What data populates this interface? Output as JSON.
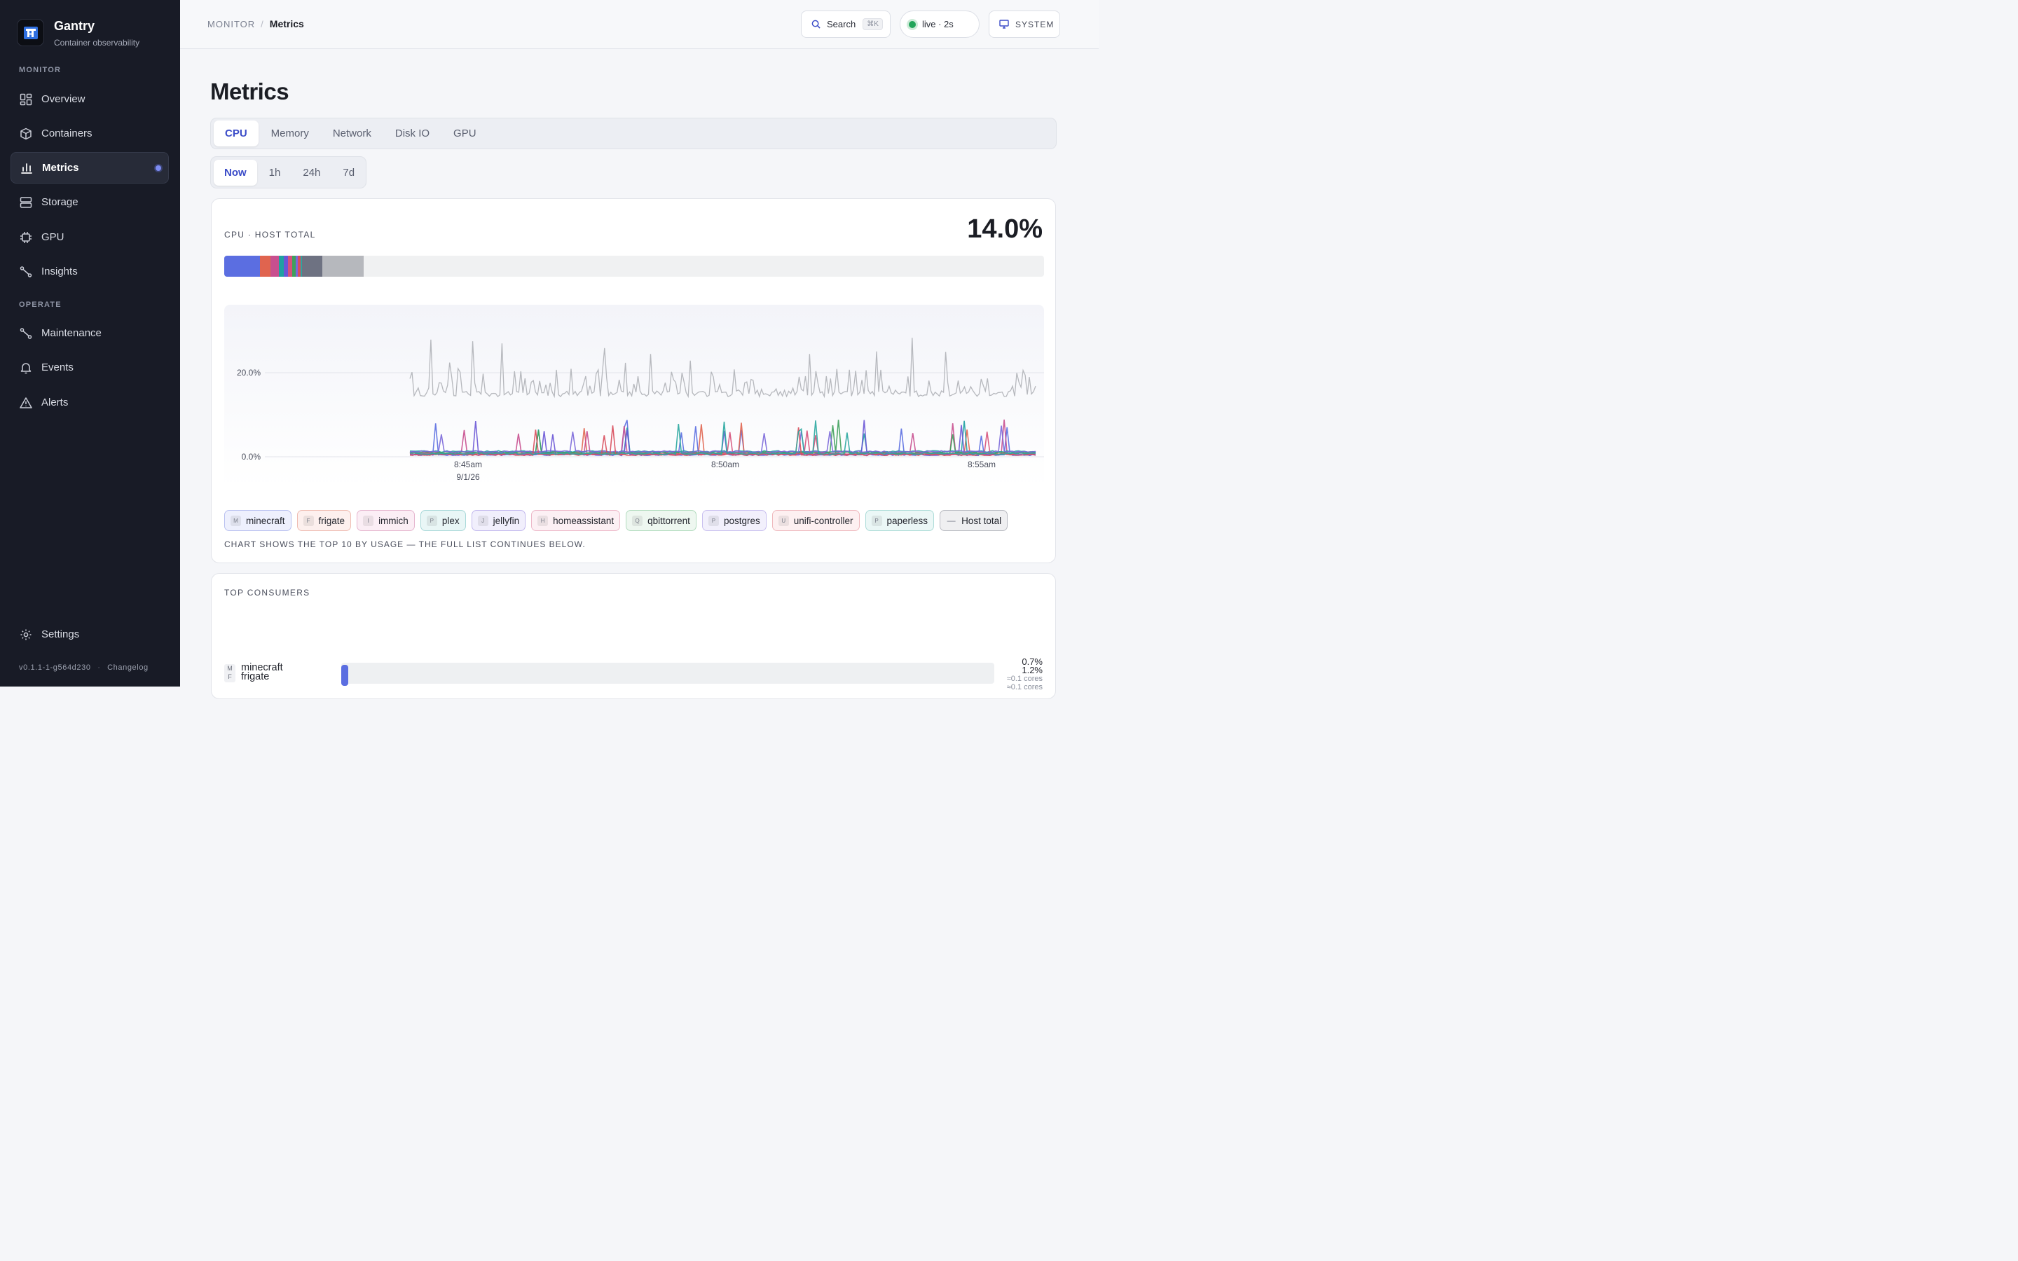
{
  "brand": {
    "name": "Gantry",
    "subtitle": "Container observability"
  },
  "sidebar": {
    "sections": [
      {
        "label": "MONITOR",
        "items": [
          {
            "label": "Overview",
            "icon": "grid-icon"
          },
          {
            "label": "Containers",
            "icon": "box-icon"
          },
          {
            "label": "Metrics",
            "icon": "bar-chart-icon",
            "active": true
          },
          {
            "label": "Storage",
            "icon": "database-icon"
          },
          {
            "label": "GPU",
            "icon": "chip-icon"
          },
          {
            "label": "Insights",
            "icon": "route-icon"
          }
        ]
      },
      {
        "label": "OPERATE",
        "items": [
          {
            "label": "Maintenance",
            "icon": "route-icon"
          },
          {
            "label": "Events",
            "icon": "bell-icon"
          },
          {
            "label": "Alerts",
            "icon": "warning-icon"
          }
        ]
      }
    ],
    "settings_label": "Settings",
    "version": "v0.1.1-1-g564d230",
    "changelog": "Changelog"
  },
  "topbar": {
    "breadcrumb_root": "MONITOR",
    "breadcrumb_current": "Metrics",
    "search_label": "Search",
    "search_shortcut": "⌘K",
    "live_label": "live · 2s",
    "theme_label": "SYSTEM"
  },
  "page": {
    "title": "Metrics",
    "tabs": [
      "CPU",
      "Memory",
      "Network",
      "Disk IO",
      "GPU"
    ],
    "active_tab": "CPU",
    "ranges": [
      "Now",
      "1h",
      "24h",
      "7d"
    ],
    "active_range": "Now"
  },
  "cpu_card": {
    "title": "CPU · HOST TOTAL",
    "value": "14.0%",
    "note": "CHART SHOWS THE TOP 10 BY USAGE — THE FULL LIST CONTINUES BELOW."
  },
  "colors": {
    "minecraft": "#5b6ee1",
    "frigate": "#e0644f",
    "immich": "#c84f8f",
    "plex": "#1fa1a1",
    "jellyfin": "#6a56d6",
    "homeassistant": "#d6517a",
    "qbittorrent": "#3fa05c",
    "postgres": "#7b68d9",
    "unifi-controller": "#d84d5b",
    "paperless": "#2aa7a0",
    "host": "#b6b8bd"
  },
  "legend": [
    {
      "badge": "M",
      "name": "minecraft",
      "bg": "#eef0fd",
      "border": "#b9c1f0"
    },
    {
      "badge": "F",
      "name": "frigate",
      "bg": "#fdf0ee",
      "border": "#efbcb2"
    },
    {
      "badge": "I",
      "name": "immich",
      "bg": "#fbeef5",
      "border": "#e6b6cf"
    },
    {
      "badge": "P",
      "name": "plex",
      "bg": "#e9f6f6",
      "border": "#a9d9d9"
    },
    {
      "badge": "J",
      "name": "jellyfin",
      "bg": "#f1effc",
      "border": "#c3b9ee"
    },
    {
      "badge": "H",
      "name": "homeassistant",
      "bg": "#fcf0f4",
      "border": "#edb8c9"
    },
    {
      "badge": "Q",
      "name": "qbittorrent",
      "bg": "#eef7f0",
      "border": "#b3dcbf"
    },
    {
      "badge": "P",
      "name": "postgres",
      "bg": "#f2f0fc",
      "border": "#c9c0ef"
    },
    {
      "badge": "U",
      "name": "unifi-controller",
      "bg": "#fdf0f1",
      "border": "#efb9be"
    },
    {
      "badge": "P",
      "name": "paperless",
      "bg": "#ebf7f6",
      "border": "#addcd8"
    },
    {
      "badge": "—",
      "name": "Host total",
      "bg": "#efeff1",
      "border": "#b9bbc2"
    }
  ],
  "chart_data": {
    "type": "line",
    "ylabel": "",
    "ylim": [
      0,
      30
    ],
    "y_ticks": [
      "0.0%",
      "20.0%"
    ],
    "x_ticks": [
      "8:45am",
      "8:50am",
      "8:55am"
    ],
    "x_date": "9/1/26",
    "host_total_range": [
      14,
      20
    ],
    "spike_times": [
      "8:44:30",
      "8:46:00",
      "8:47:00",
      "8:48:00",
      "8:49:00",
      "8:50:00",
      "8:51:00",
      "8:52:00",
      "8:53:00",
      "8:54:00",
      "8:55:30"
    ]
  },
  "stack_segments": [
    {
      "name": "minecraft",
      "pct": 4.4
    },
    {
      "name": "frigate",
      "pct": 1.2
    },
    {
      "name": "immich",
      "pct": 1.1
    },
    {
      "name": "plex",
      "pct": 0.6
    },
    {
      "name": "jellyfin",
      "pct": 0.5
    },
    {
      "name": "homeassistant",
      "pct": 0.5
    },
    {
      "name": "qbittorrent",
      "pct": 0.4
    },
    {
      "name": "postgres",
      "pct": 0.3
    },
    {
      "name": "unifi-controller",
      "pct": 0.3
    },
    {
      "name": "paperless",
      "pct": 0.2
    },
    {
      "name": "other",
      "pct": 2.5
    },
    {
      "name": "host",
      "pct": 5.0
    }
  ],
  "top_consumers": {
    "title": "TOP CONSUMERS",
    "rows": [
      {
        "badge": "M",
        "name": "minecraft",
        "value": "0.7%",
        "cores": "≈0.1 cores"
      },
      {
        "badge": "F",
        "name": "frigate",
        "value": "1.2%",
        "cores": "≈0.1 cores"
      }
    ]
  }
}
